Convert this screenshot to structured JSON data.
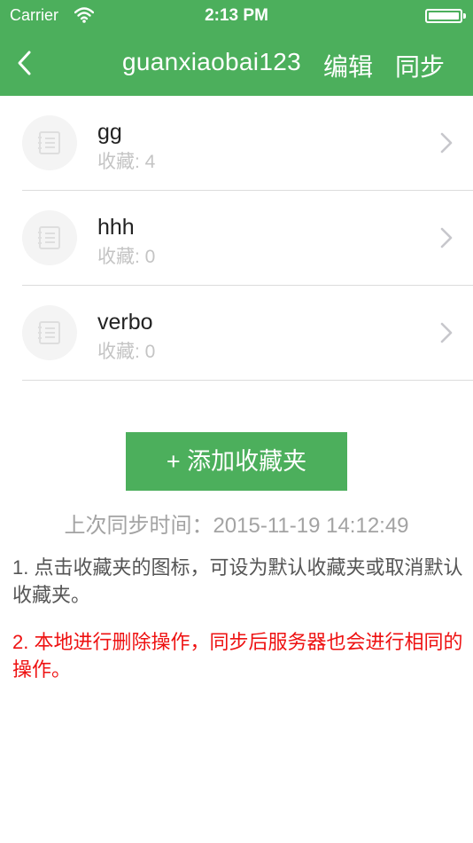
{
  "status_bar": {
    "carrier": "Carrier",
    "time": "2:13 PM"
  },
  "nav": {
    "title": "guanxiaobai123",
    "edit_label": "编辑",
    "sync_label": "同步"
  },
  "folders": [
    {
      "name": "gg",
      "count_text": "收藏: 4"
    },
    {
      "name": "hhh",
      "count_text": "收藏: 0"
    },
    {
      "name": "verbo",
      "count_text": "收藏: 0"
    }
  ],
  "add_button_label": "+ 添加收藏夹",
  "last_sync": "上次同步时间：2015-11-19 14:12:49",
  "notes": [
    "1. 点击收藏夹的图标，可设为默认收藏夹或取消默认收藏夹。",
    "2. 本地进行删除操作，同步后服务器也会进行相同的操作。"
  ],
  "colors": {
    "brand_green": "#4caf5c",
    "warning_red": "#ee1111"
  }
}
